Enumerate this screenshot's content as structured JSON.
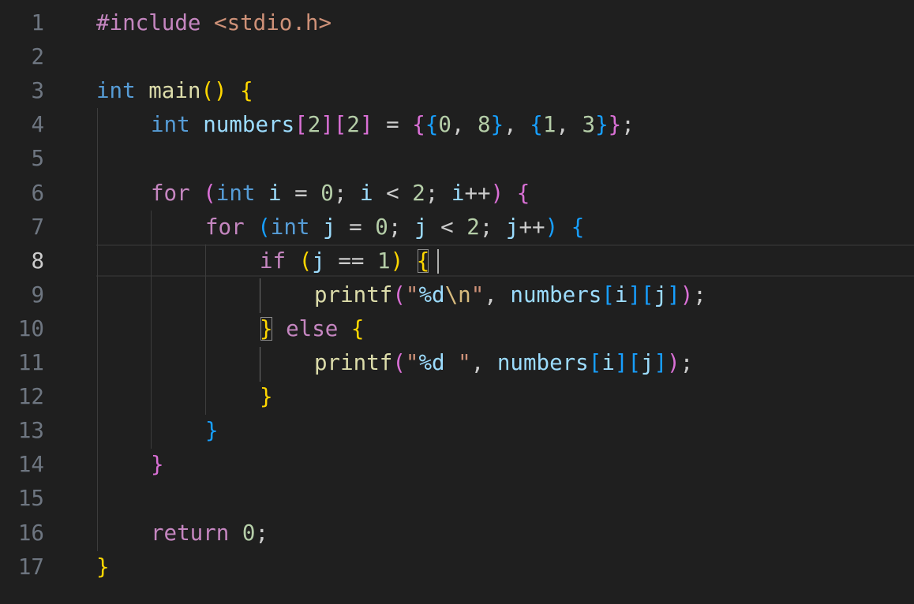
{
  "editor": {
    "line_numbers": [
      "1",
      "2",
      "3",
      "4",
      "5",
      "6",
      "7",
      "8",
      "9",
      "10",
      "11",
      "12",
      "13",
      "14",
      "15",
      "16",
      "17"
    ],
    "active_line": "8",
    "tokens": {
      "include_directive": "#include",
      "include_header": "<stdio.h>",
      "kw_int": "int",
      "fn_main": "main",
      "paren_open": "(",
      "paren_close": ")",
      "paren_pair": "()",
      "brace_open": "{",
      "brace_close": "}",
      "brace_open_double": "{{",
      "brace_close_double": "}}",
      "bracket_open": "[",
      "bracket_close": "]",
      "var_numbers": "numbers",
      "var_i": "i",
      "var_j": "j",
      "num_0": "0",
      "num_1": "1",
      "num_2": "2",
      "num_3": "3",
      "num_8": "8",
      "kw_for": "for",
      "kw_if": "if",
      "kw_else": "else",
      "kw_return": "return",
      "fn_printf": "printf",
      "quote": "\"",
      "fmt_d": "%d",
      "esc_n": "\\n",
      "str_space": " ",
      "op_assign": " = ",
      "op_lt": " < ",
      "op_eq": " == ",
      "op_inc": "++",
      "semi": ";",
      "comma_sp": ", ",
      "semi_sp": "; ",
      "space": " "
    }
  }
}
